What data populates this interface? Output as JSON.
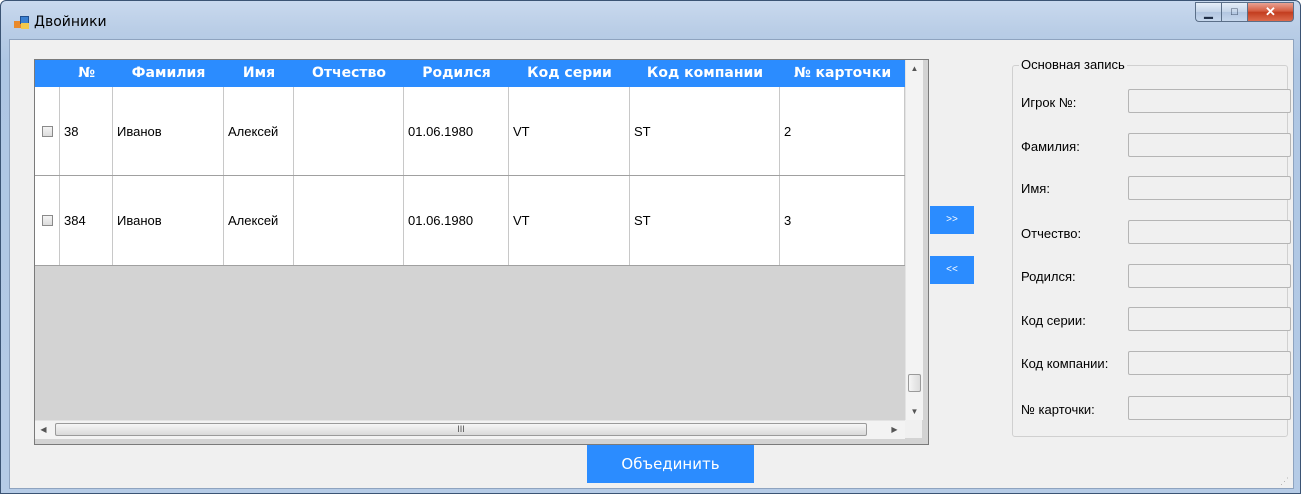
{
  "window": {
    "title": "Двойники"
  },
  "grid": {
    "columns": [
      "№",
      "Фамилия",
      "Имя",
      "Отчество",
      "Родился",
      "Код серии",
      "Код компании",
      "№ карточки"
    ],
    "rows": [
      {
        "num": "38",
        "surname": "Иванов",
        "name": "Алексей",
        "patronymic": "",
        "born": "01.06.1980",
        "series": "VT",
        "company": "ST",
        "card": "2"
      },
      {
        "num": "384",
        "surname": "Иванов",
        "name": "Алексей",
        "patronymic": "",
        "born": "01.06.1980",
        "series": "VT",
        "company": "ST",
        "card": "3"
      }
    ],
    "hscroll_glyph": "III"
  },
  "buttons": {
    "move_right": ">>",
    "move_left": "<<",
    "merge": "Объединить"
  },
  "main_record": {
    "legend": "Основная запись",
    "fields": [
      {
        "label": "Игрок №:",
        "value": ""
      },
      {
        "label": "Фамилия:",
        "value": ""
      },
      {
        "label": "Имя:",
        "value": ""
      },
      {
        "label": "Отчество:",
        "value": ""
      },
      {
        "label": "Родился:",
        "value": ""
      },
      {
        "label": "Код серии:",
        "value": ""
      },
      {
        "label": "Код компании:",
        "value": ""
      },
      {
        "label": "№ карточки:",
        "value": ""
      }
    ]
  },
  "colors": {
    "accent": "#2b8cff",
    "grid_background": "#d3d3d3"
  }
}
